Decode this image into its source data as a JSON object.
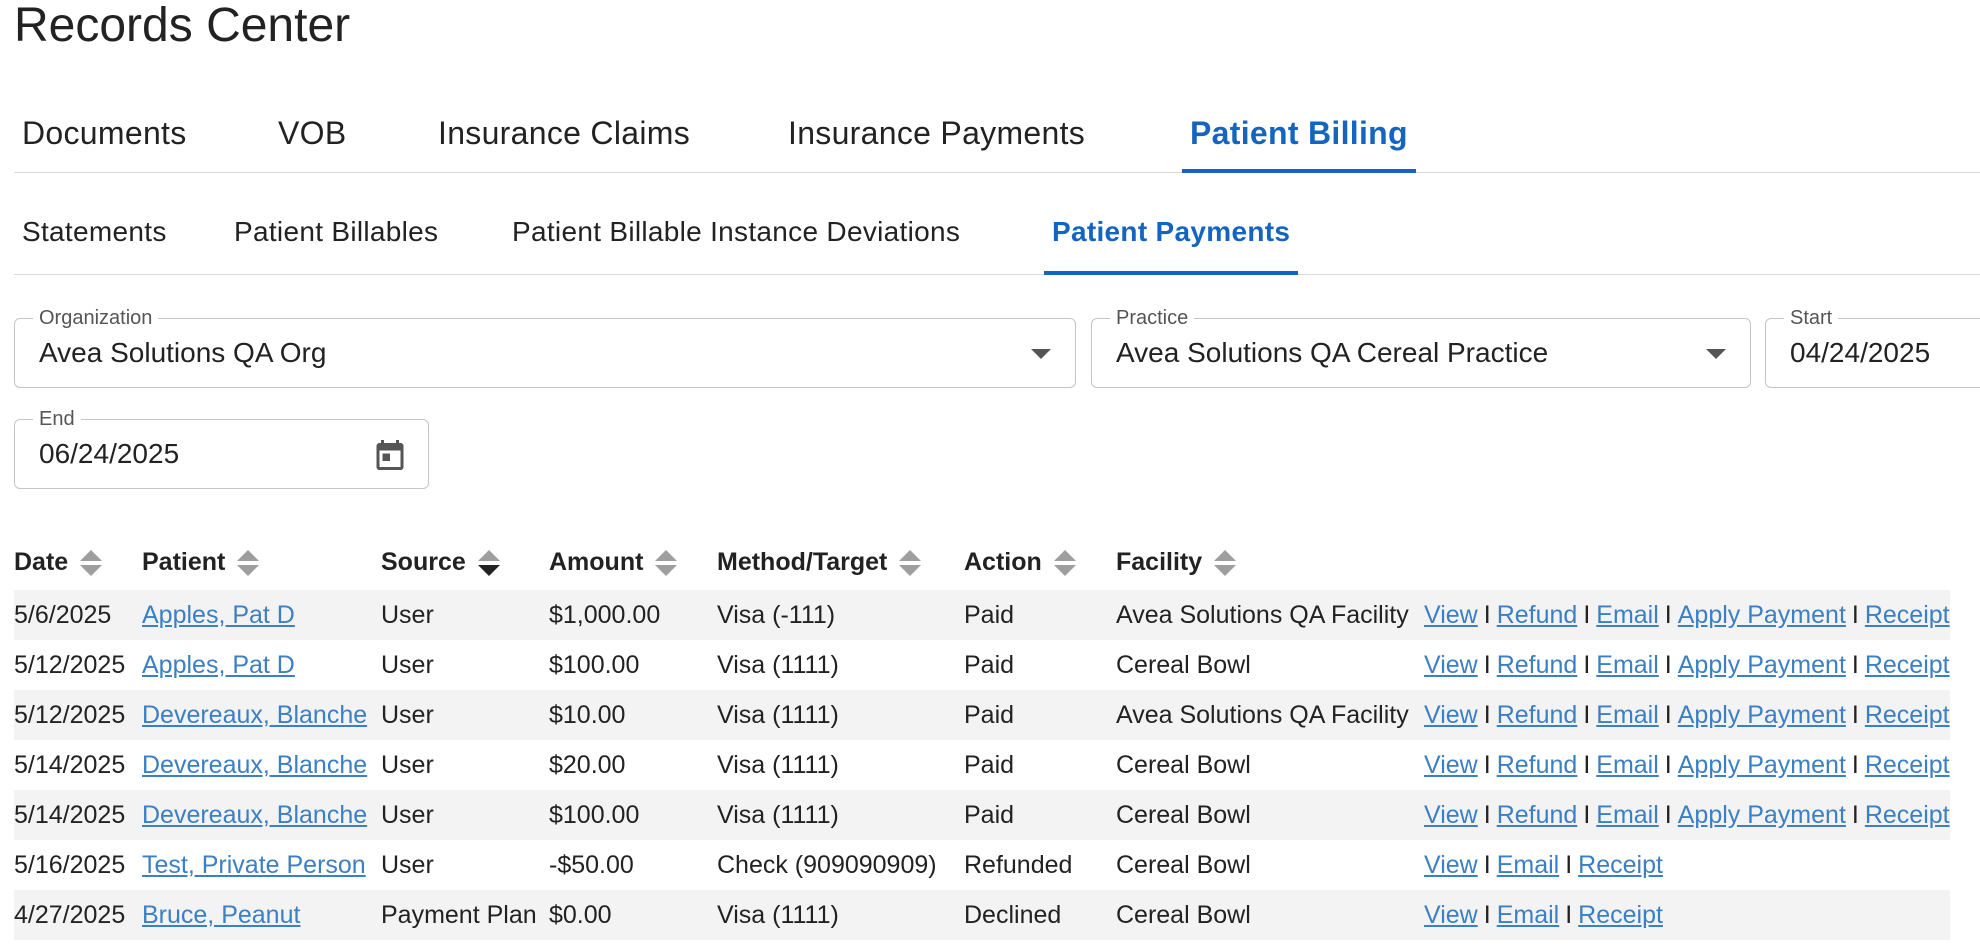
{
  "page_title": "Records Center",
  "main_tabs": [
    {
      "label": "Documents"
    },
    {
      "label": "VOB"
    },
    {
      "label": "Insurance Claims"
    },
    {
      "label": "Insurance Payments"
    },
    {
      "label": "Patient Billing"
    }
  ],
  "sub_tabs": [
    {
      "label": "Statements"
    },
    {
      "label": "Patient Billables"
    },
    {
      "label": "Patient Billable Instance Deviations"
    },
    {
      "label": "Patient Payments"
    }
  ],
  "filters": {
    "organization": {
      "label": "Organization",
      "value": "Avea Solutions QA Org"
    },
    "practice": {
      "label": "Practice",
      "value": "Avea Solutions QA Cereal Practice"
    },
    "start": {
      "label": "Start",
      "value": "04/24/2025"
    },
    "end": {
      "label": "End",
      "value": "06/24/2025"
    }
  },
  "table": {
    "columns": [
      "Date",
      "Patient",
      "Source",
      "Amount",
      "Method/Target",
      "Action",
      "Facility"
    ],
    "action_labels": {
      "view": "View",
      "refund": "Refund",
      "email": "Email",
      "apply": "Apply Payment",
      "receipt": "Receipt",
      "sep": "I"
    },
    "rows": [
      {
        "date": "5/6/2025",
        "patient": "Apples, Pat D",
        "source": "User",
        "amount": "$1,000.00",
        "method": "Visa (-111)",
        "action": "Paid",
        "facility": "Avea Solutions QA Facility",
        "full_actions": true
      },
      {
        "date": "5/12/2025",
        "patient": "Apples, Pat D",
        "source": "User",
        "amount": "$100.00",
        "method": "Visa (1111)",
        "action": "Paid",
        "facility": "Cereal Bowl",
        "full_actions": true
      },
      {
        "date": "5/12/2025",
        "patient": "Devereaux, Blanche",
        "source": "User",
        "amount": "$10.00",
        "method": "Visa (1111)",
        "action": "Paid",
        "facility": "Avea Solutions QA Facility",
        "full_actions": true
      },
      {
        "date": "5/14/2025",
        "patient": "Devereaux, Blanche",
        "source": "User",
        "amount": "$20.00",
        "method": "Visa (1111)",
        "action": "Paid",
        "facility": "Cereal Bowl",
        "full_actions": true
      },
      {
        "date": "5/14/2025",
        "patient": "Devereaux, Blanche",
        "source": "User",
        "amount": "$100.00",
        "method": "Visa (1111)",
        "action": "Paid",
        "facility": "Cereal Bowl",
        "full_actions": true
      },
      {
        "date": "5/16/2025",
        "patient": "Test, Private Person",
        "source": "User",
        "amount": "-$50.00",
        "method": "Check (909090909)",
        "action": "Refunded",
        "facility": "Cereal Bowl",
        "full_actions": false
      },
      {
        "date": "4/27/2025",
        "patient": "Bruce, Peanut",
        "source": "Payment Plan",
        "amount": "$0.00",
        "method": "Visa (1111)",
        "action": "Declined",
        "facility": "Cereal Bowl",
        "full_actions": false
      }
    ]
  },
  "colors": {
    "accent": "#1565c0",
    "link": "#3b7fc4",
    "row_stripe": "#f3f3f3"
  }
}
